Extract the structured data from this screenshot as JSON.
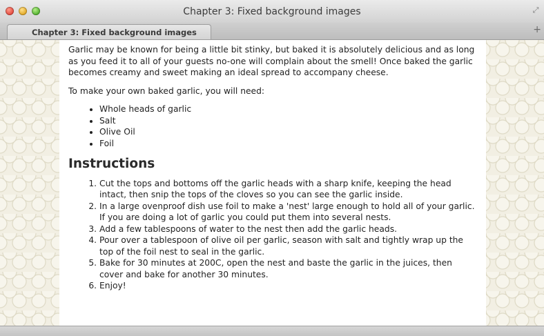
{
  "window": {
    "title": "Chapter 3: Fixed background images"
  },
  "tab": {
    "label": "Chapter 3: Fixed background images",
    "new_tab": "+"
  },
  "article": {
    "intro": "Garlic may be known for being a little bit stinky, but baked it is absolutely delicious and as long as you feed it to all of your guests no-one will complain about the smell! Once baked the garlic becomes creamy and sweet making an ideal spread to accompany cheese.",
    "need": "To make your own baked garlic, you will need:",
    "ingredients": [
      "Whole heads of garlic",
      "Salt",
      "Olive Oil",
      "Foil"
    ],
    "heading": "Instructions",
    "steps": [
      "Cut the tops and bottoms off the garlic heads with a sharp knife, keeping the head intact, then snip the tops of the cloves so you can see the garlic inside.",
      "In a large ovenproof dish use foil to make a 'nest' large enough to hold all of your garlic. If you are doing a lot of garlic you could put them into several nests.",
      "Add a few tablespoons of water to the nest then add the garlic heads.",
      "Pour over a tablespoon of olive oil per garlic, season with salt and tightly wrap up the top of the foil nest to seal in the garlic.",
      "Bake for 30 minutes at 200C, open the nest and baste the garlic in the juices, then cover and bake for another 30 minutes.",
      "Enjoy!"
    ]
  }
}
